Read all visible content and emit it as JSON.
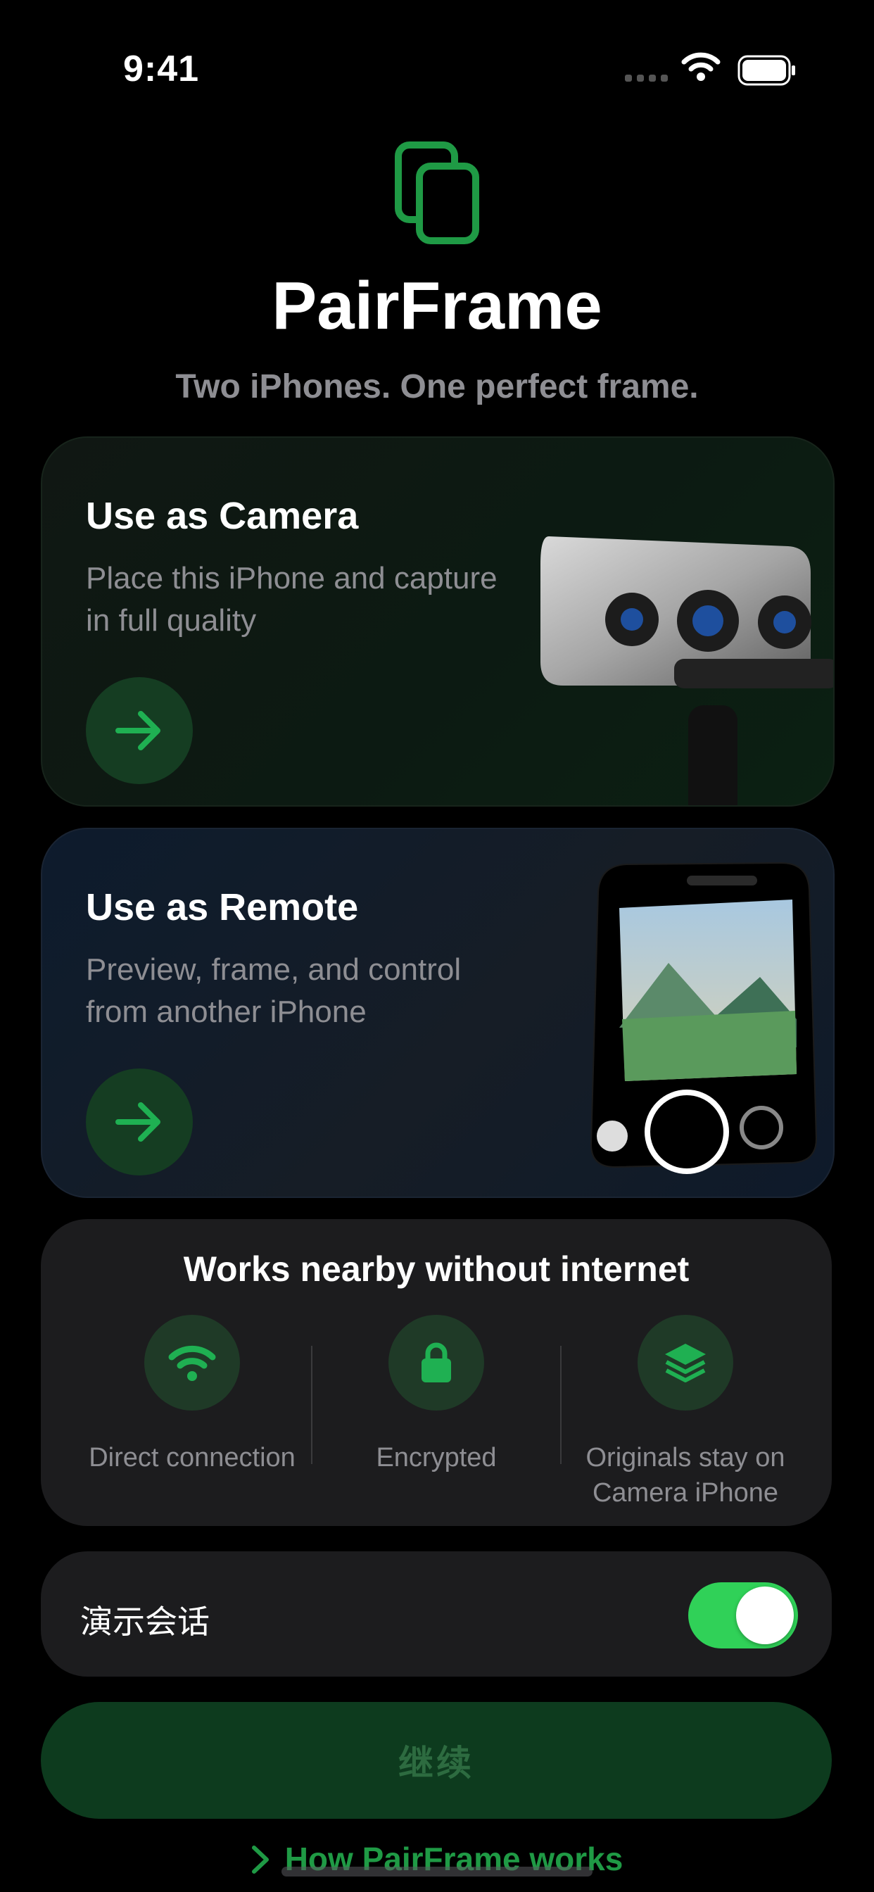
{
  "status_bar": {
    "time": "9:41"
  },
  "header": {
    "app_name": "PairFrame",
    "tagline": "Two iPhones. One perfect frame."
  },
  "modes": [
    {
      "title": "Use as Camera",
      "description": "Place this iPhone and capture\nin full quality",
      "icon": "arrow-right-icon"
    },
    {
      "title": "Use as Remote",
      "description": "Preview, frame, and control\nfrom another iPhone",
      "icon": "arrow-right-icon"
    }
  ],
  "info": {
    "title": "Works nearby without internet",
    "features": [
      {
        "label": "Direct connection",
        "icon": "wifi-icon"
      },
      {
        "label": "Encrypted",
        "icon": "lock-icon"
      },
      {
        "label": "Originals stay on\nCamera iPhone",
        "icon": "layers-icon"
      }
    ]
  },
  "demo_session": {
    "label": "演示会话",
    "enabled": true
  },
  "continue_label": "继续",
  "how_link": "How PairFrame works",
  "colors": {
    "accent": "#1f9a45",
    "toggle_on": "#30d158",
    "card_bg": "#1c1c1e"
  }
}
